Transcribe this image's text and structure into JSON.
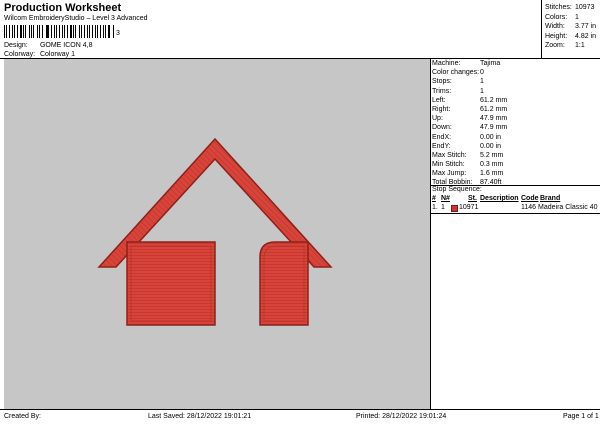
{
  "header": {
    "title": "Production Worksheet",
    "subtitle": "Wilcom EmbroideryStudio – Level 3 Advanced",
    "barcode_suffix": "3",
    "design_label": "Design:",
    "design_value": "GOME ICON 4,8",
    "colorway_label": "Colorway:",
    "colorway_value": "Colorway 1"
  },
  "top_stats": [
    {
      "label": "Stitches:",
      "value": "10973"
    },
    {
      "label": "Colors:",
      "value": "1"
    },
    {
      "label": "Width:",
      "value": "3.77 in"
    },
    {
      "label": "Height:",
      "value": "4.82 in"
    },
    {
      "label": "Zoom:",
      "value": "1:1"
    }
  ],
  "machine_info": [
    {
      "label": "Machine:",
      "value": "Tajima"
    },
    {
      "label": "Color changes:",
      "value": "0"
    },
    {
      "label": "Stops:",
      "value": "1"
    },
    {
      "label": "Trims:",
      "value": "1"
    },
    {
      "label": "Left:",
      "value": "61.2 mm"
    },
    {
      "label": "Right:",
      "value": "61.2 mm"
    },
    {
      "label": "Up:",
      "value": "47.9 mm"
    },
    {
      "label": "Down:",
      "value": "47.9 mm"
    },
    {
      "label": "EndX:",
      "value": "0.00 in"
    },
    {
      "label": "EndY:",
      "value": "0.00 in"
    },
    {
      "label": "Max Stitch:",
      "value": "5.2 mm"
    },
    {
      "label": "Min Stitch:",
      "value": "0.3 mm"
    },
    {
      "label": "Max Jump:",
      "value": "1.6 mm"
    },
    {
      "label": "Total Bobbin:",
      "value": "87.40ft"
    }
  ],
  "stop_sequence": {
    "title": "Stop Sequence:",
    "columns": [
      "#",
      "N#",
      "St.",
      "Description",
      "Code",
      "Brand"
    ],
    "rows": [
      {
        "num": "1.",
        "n": "1",
        "stitches": "10971",
        "description": "",
        "code": "1146",
        "brand": "Madeira Classic 40",
        "color": "#cc3333"
      }
    ]
  },
  "footer": {
    "created_by": "Created By:",
    "last_saved": "Last Saved: 28/12/2022 19:01:21",
    "printed": "Printed: 28/12/2022 19:01:24",
    "page": "Page 1 of 1"
  },
  "design_colors": {
    "fill": "#d9443a",
    "stitch": "#b83228",
    "outline": "#8e2018",
    "background": "#c6c6c6"
  }
}
